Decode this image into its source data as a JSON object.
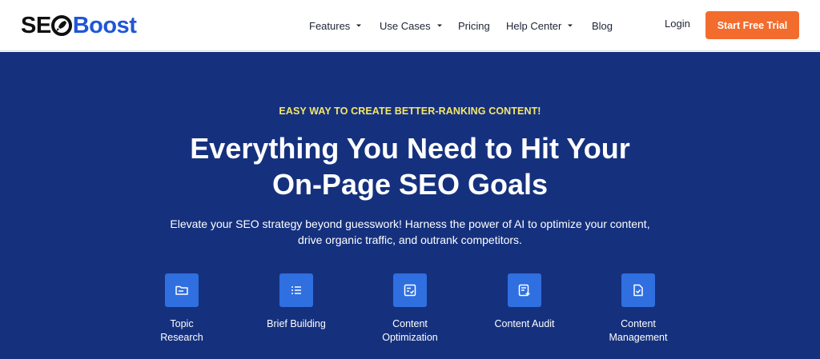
{
  "header": {
    "logo": {
      "part1": "SE",
      "part2": "Boost"
    },
    "nav": [
      {
        "label": "Features",
        "dropdown": true
      },
      {
        "label": "Use Cases",
        "dropdown": true
      },
      {
        "label": "Pricing",
        "dropdown": false
      },
      {
        "label": "Help Center",
        "dropdown": true
      },
      {
        "label": "Blog",
        "dropdown": false
      }
    ],
    "login_label": "Login",
    "cta_label": "Start Free Trial"
  },
  "hero": {
    "eyebrow": "EASY WAY TO CREATE BETTER-RANKING CONTENT!",
    "headline_line1": "Everything You Need to Hit Your",
    "headline_line2": "On-Page SEO Goals",
    "subtext_line1": "Elevate your SEO strategy beyond guesswork! Harness the power of AI to optimize your content,",
    "subtext_line2": "drive organic traffic, and outrank competitors."
  },
  "features": [
    {
      "line1": "Topic",
      "line2": "Research",
      "icon": "folder-icon"
    },
    {
      "line1": "Brief Building",
      "line2": "",
      "icon": "list-icon"
    },
    {
      "line1": "Content",
      "line2": "Optimization",
      "icon": "checklist-icon"
    },
    {
      "line1": "Content Audit",
      "line2": "",
      "icon": "document-add-icon"
    },
    {
      "line1": "Content",
      "line2": "Management",
      "icon": "document-check-icon"
    }
  ],
  "colors": {
    "brand_blue": "#1f56d6",
    "hero_background": "#15317e",
    "accent_orange": "#f26c2e",
    "eyebrow_yellow": "#f5e66a",
    "icon_tile": "#2f6fe0"
  }
}
